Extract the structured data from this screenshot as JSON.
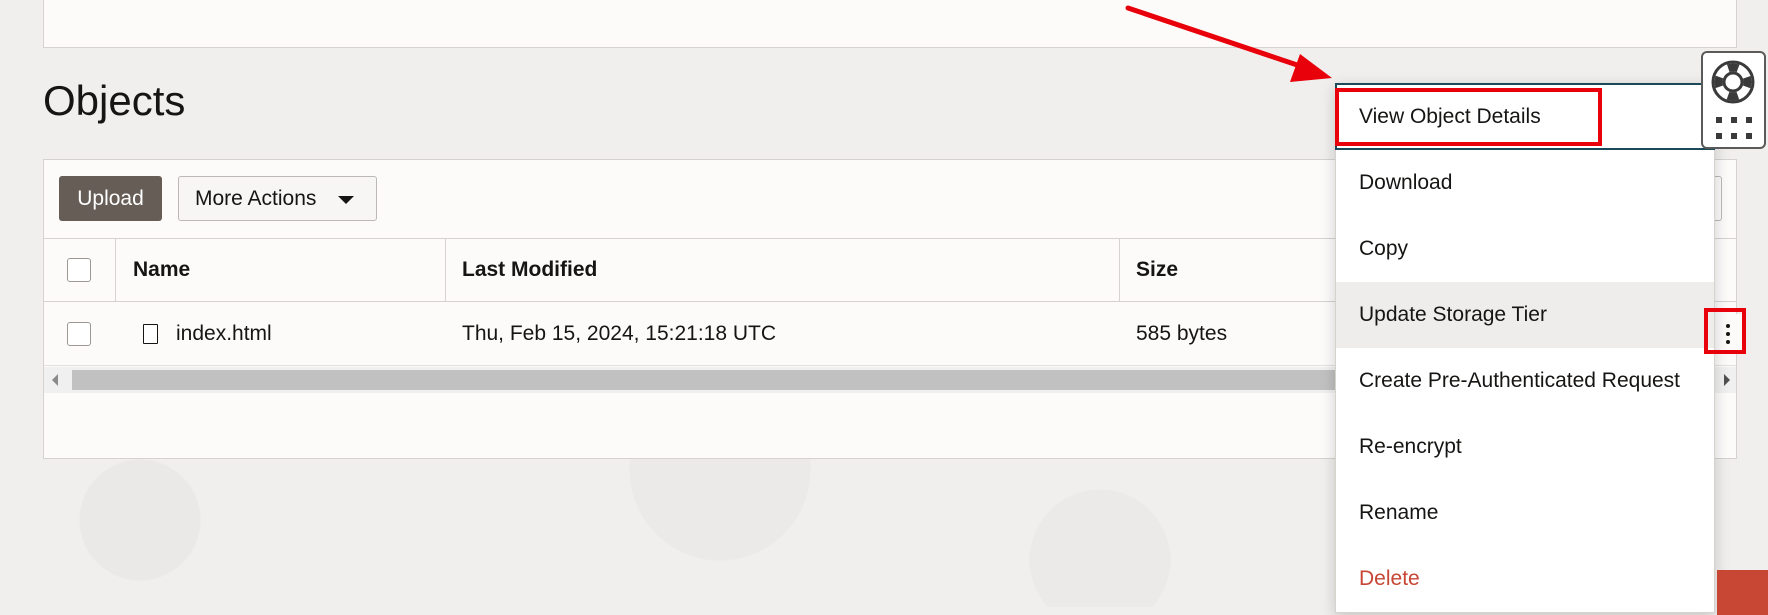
{
  "page": {
    "title": "Objects"
  },
  "toolbar": {
    "upload_label": "Upload",
    "more_actions_label": "More Actions"
  },
  "table": {
    "columns": [
      "Name",
      "Last Modified",
      "Size"
    ],
    "rows": [
      {
        "name": "index.html",
        "last_modified": "Thu, Feb 15, 2024, 15:21:18 UTC",
        "size": "585 bytes"
      }
    ]
  },
  "context_menu": {
    "items": [
      {
        "label": "View Object Details"
      },
      {
        "label": "Download"
      },
      {
        "label": "Copy"
      },
      {
        "label": "Update Storage Tier"
      },
      {
        "label": "Create Pre-Authenticated Request"
      },
      {
        "label": "Re-encrypt"
      },
      {
        "label": "Rename"
      },
      {
        "label": "Delete"
      }
    ]
  },
  "icons": {
    "row_file": "file-icon",
    "row_actions": "kebab-menu-icon",
    "help": "lifebuoy-icon",
    "apps": "grid-dots-icon",
    "dropdown": "caret-down-icon"
  },
  "colors": {
    "primary_button": "#665e56",
    "danger_text": "#c74634",
    "annotation": "#e8000a",
    "page_bg": "#f1efed"
  }
}
